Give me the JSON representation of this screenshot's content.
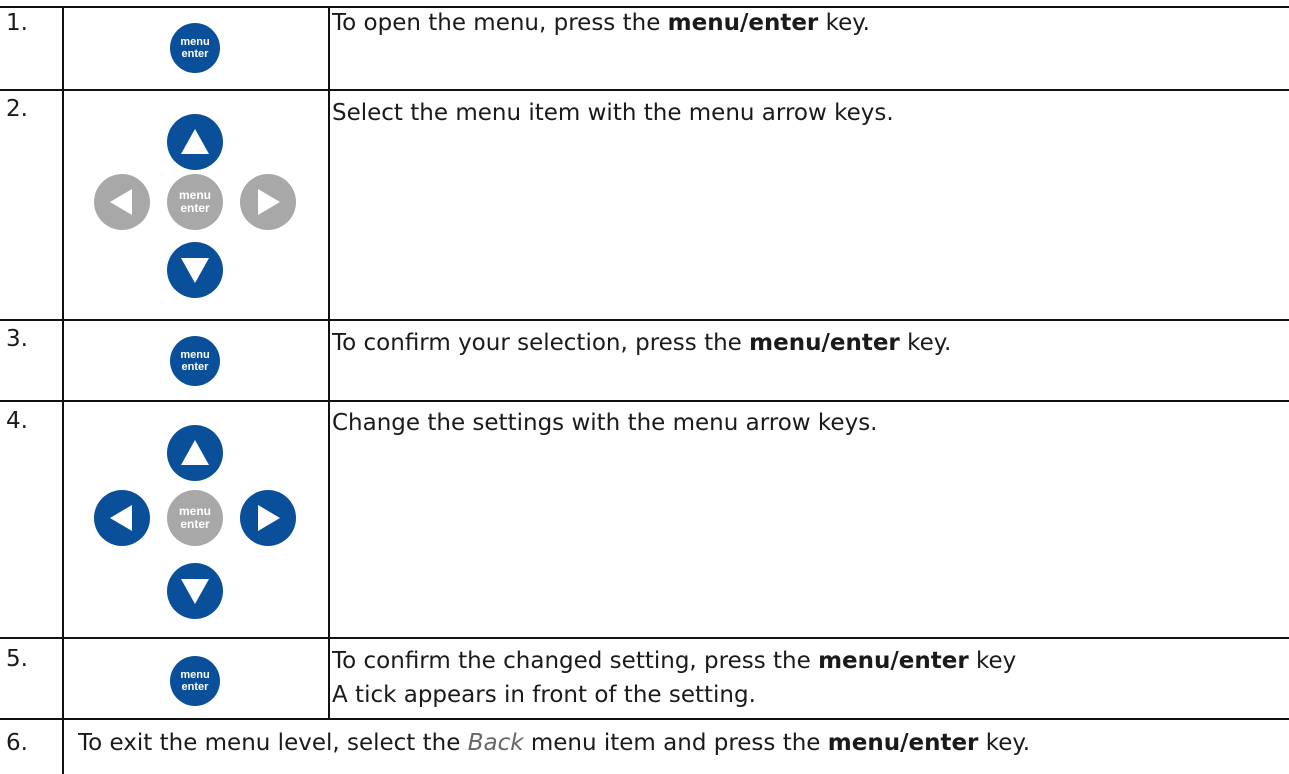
{
  "colors": {
    "key_active": "#0a4f9a",
    "key_inactive": "#a8a8a8"
  },
  "key_text": {
    "line1": "menu",
    "line2": "enter"
  },
  "steps": [
    {
      "number": "1.",
      "text_before": "To open the menu, press the ",
      "bold": "menu/enter",
      "text_after": " key."
    },
    {
      "number": "2.",
      "text": "Select the menu item with the menu arrow keys."
    },
    {
      "number": "3.",
      "text_before": "To confirm your selection, press the ",
      "bold": "menu/enter",
      "text_after": " key."
    },
    {
      "number": "4.",
      "text": "Change the settings with the menu arrow keys."
    },
    {
      "number": "5.",
      "text_before": "To confirm the changed setting, press the ",
      "bold": "menu/enter",
      "text_after": " key",
      "line2": "A tick appears in front of the setting."
    },
    {
      "number": "6.",
      "text_before": "To exit the menu level, select the ",
      "italic": "Back",
      "text_middle": " menu item and press the ",
      "bold": "menu/enter",
      "text_after": " key."
    }
  ]
}
